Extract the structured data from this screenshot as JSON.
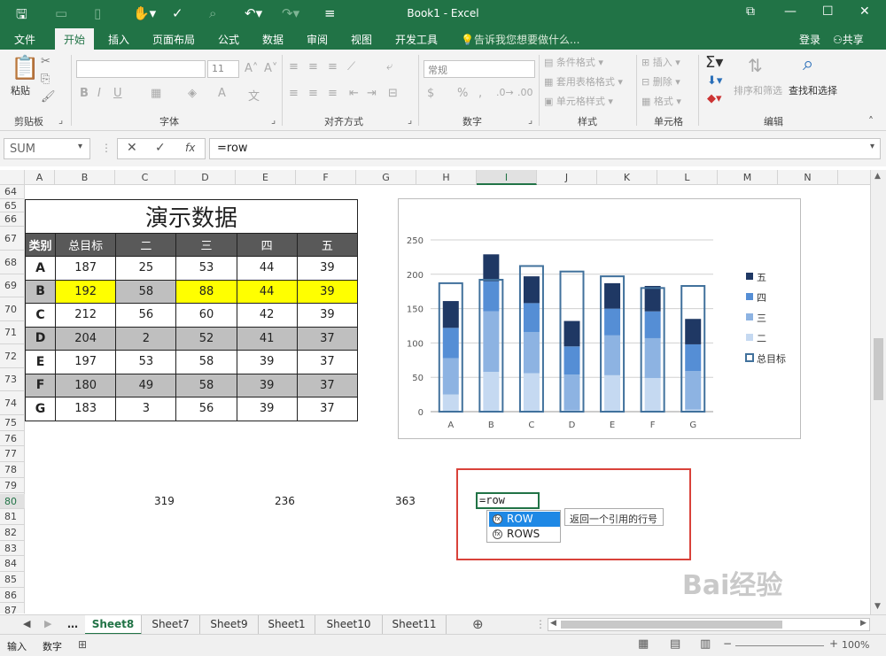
{
  "titlebar": {
    "title": "Book1 - Excel"
  },
  "tabs": [
    "文件",
    "开始",
    "插入",
    "页面布局",
    "公式",
    "数据",
    "审阅",
    "视图",
    "开发工具"
  ],
  "tell_me": "告诉我您想要做什么...",
  "login": "登录",
  "share": "共享",
  "ribbon": {
    "clipboard": {
      "paste": "粘贴",
      "label": "剪贴板"
    },
    "font": {
      "size": "11",
      "label": "字体"
    },
    "alignment": {
      "label": "对齐方式"
    },
    "number": {
      "format": "常规",
      "label": "数字"
    },
    "styles": {
      "cond": "条件格式",
      "table": "套用表格格式",
      "cell": "单元格样式",
      "label": "样式"
    },
    "cells": {
      "insert": "插入",
      "delete": "删除",
      "format": "格式",
      "label": "单元格"
    },
    "editing": {
      "sort": "排序和筛选",
      "find": "查找和选择",
      "label": "编辑"
    }
  },
  "formula_bar": {
    "name_box": "SUM",
    "formula": "=row"
  },
  "columns": [
    "A",
    "B",
    "C",
    "D",
    "E",
    "F",
    "G",
    "H",
    "I",
    "J",
    "K",
    "L",
    "M",
    "N"
  ],
  "rows": [
    "64",
    "65",
    "66",
    "67",
    "68",
    "69",
    "70",
    "71",
    "72",
    "73",
    "74",
    "75",
    "76",
    "77",
    "78",
    "79",
    "80",
    "81",
    "82",
    "83",
    "84",
    "85",
    "86",
    "87"
  ],
  "table": {
    "title": "演示数据",
    "headers": [
      "类别",
      "总目标",
      "二",
      "三",
      "四",
      "五"
    ],
    "rows": [
      [
        "A",
        "187",
        "25",
        "53",
        "44",
        "39"
      ],
      [
        "B",
        "192",
        "58",
        "88",
        "44",
        "39"
      ],
      [
        "C",
        "212",
        "56",
        "60",
        "42",
        "39"
      ],
      [
        "D",
        "204",
        "2",
        "52",
        "41",
        "37"
      ],
      [
        "E",
        "197",
        "53",
        "58",
        "39",
        "37"
      ],
      [
        "F",
        "180",
        "49",
        "58",
        "39",
        "37"
      ],
      [
        "G",
        "183",
        "3",
        "56",
        "39",
        "37"
      ]
    ]
  },
  "loose_values": [
    "319",
    "236",
    "363"
  ],
  "colors": {
    "excel_green": "#217346",
    "header_gray": "#595959",
    "row_gray": "#bfbfbf",
    "highlight_yellow": "#ffff00",
    "s_er": "#c5d9f1",
    "s_san": "#8db3e2",
    "s_si": "#558ed5",
    "s_wu": "#1f3864",
    "target_outline": "#41719c"
  },
  "chart_data": {
    "type": "bar",
    "stacked": true,
    "categories": [
      "A",
      "B",
      "C",
      "D",
      "E",
      "F",
      "G"
    ],
    "series": [
      {
        "name": "二",
        "values": [
          25,
          58,
          56,
          2,
          53,
          49,
          3
        ]
      },
      {
        "name": "三",
        "values": [
          53,
          88,
          60,
          52,
          58,
          58,
          56
        ]
      },
      {
        "name": "四",
        "values": [
          44,
          44,
          42,
          41,
          39,
          39,
          39
        ]
      },
      {
        "name": "五",
        "values": [
          39,
          39,
          39,
          37,
          37,
          37,
          37
        ]
      },
      {
        "name": "总目标",
        "values": [
          187,
          192,
          212,
          204,
          197,
          180,
          183
        ]
      }
    ],
    "yticks": [
      "0",
      "50",
      "100",
      "150",
      "200",
      "250"
    ],
    "ylim": [
      0,
      250
    ],
    "legend": [
      "五",
      "四",
      "三",
      "二",
      "总目标"
    ],
    "legend_position": "right",
    "grid": true
  },
  "cell_edit": "=row",
  "autocomplete": {
    "items": [
      "ROW",
      "ROWS"
    ],
    "tooltip": "返回一个引用的行号"
  },
  "sheets": [
    "Sheet8",
    "Sheet7",
    "Sheet9",
    "Sheet1",
    "Sheet10",
    "Sheet11"
  ],
  "status": {
    "mode": "输入",
    "num": "数字",
    "zoom": "100%"
  },
  "watermark": "Bai经验"
}
